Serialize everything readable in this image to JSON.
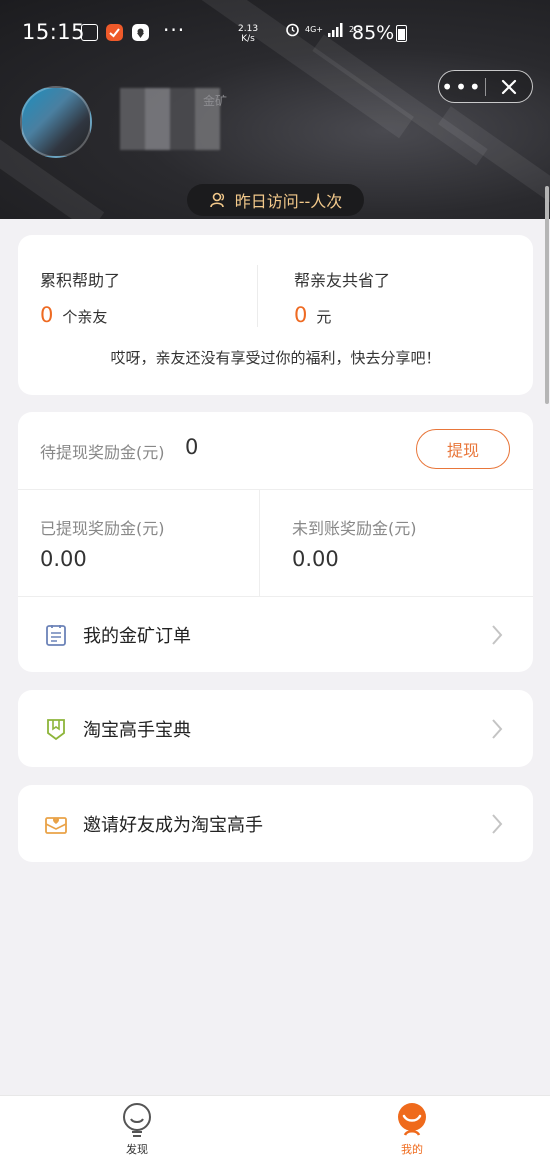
{
  "status_bar": {
    "time": "15:15",
    "net_speed_value": "2.13",
    "net_speed_unit": "K/s",
    "network_type": "4G+",
    "signal_label": "2G",
    "battery": "85%",
    "icons": [
      "image-icon",
      "app-notification-icon",
      "location-pin-icon",
      "more-dots-icon",
      "alarm-icon",
      "signal-icon",
      "battery-icon"
    ]
  },
  "header": {
    "nickname_suffix": "金矿",
    "visits_pill": "昨日访问--人次",
    "capsule_more": "•••"
  },
  "stats": {
    "helped_label": "累积帮助了",
    "helped_value": "0",
    "helped_unit": "个亲友",
    "saved_label": "帮亲友共省了",
    "saved_value": "0",
    "saved_unit": "元",
    "hint": "哎呀，亲友还没有享受过你的福利，快去分享吧！"
  },
  "wallet": {
    "pending_label": "待提现奖励金(元)",
    "pending_value": "0",
    "withdraw_button": "提现",
    "withdrawn_label": "已提现奖励金(元)",
    "withdrawn_value": "0.00",
    "unsettled_label": "未到账奖励金(元)",
    "unsettled_value": "0.00",
    "orders_label": "我的金矿订单"
  },
  "menu": {
    "guide_label": "淘宝高手宝典",
    "invite_label": "邀请好友成为淘宝高手"
  },
  "tabbar": {
    "discover": "发现",
    "mine": "我的"
  },
  "colors": {
    "accent": "#ee6a22",
    "pill_text": "#f3c98b",
    "guide_icon": "#8db53a",
    "invite_icon": "#e9a247",
    "orders_icon": "#6c83b8"
  }
}
